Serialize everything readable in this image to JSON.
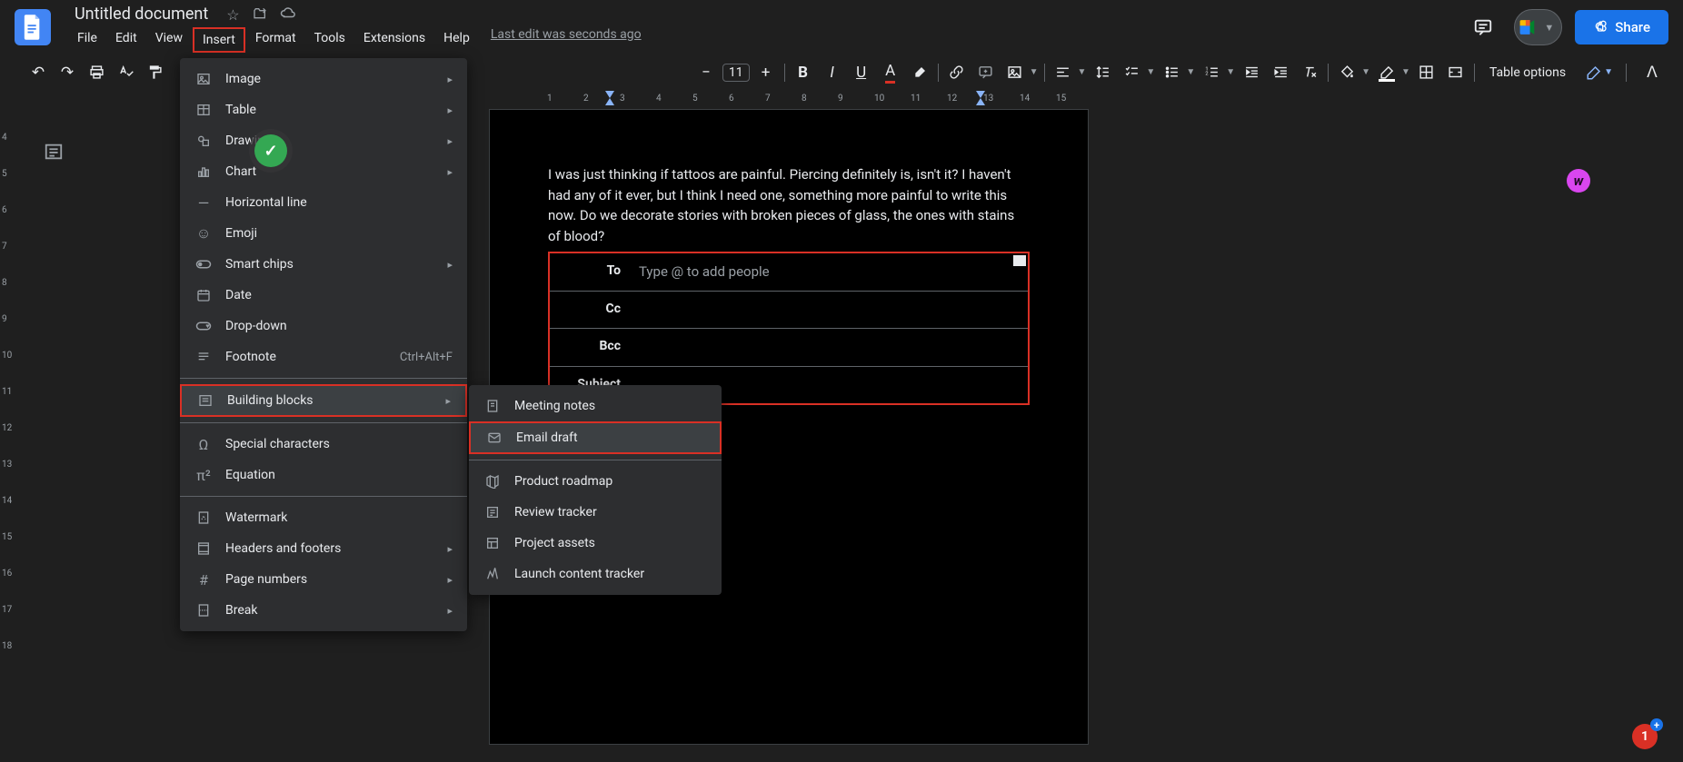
{
  "app": {
    "doc_title": "Untitled document",
    "last_edit": "Last edit was seconds ago"
  },
  "menubar": [
    "File",
    "Edit",
    "View",
    "Insert",
    "Format",
    "Tools",
    "Extensions",
    "Help"
  ],
  "header": {
    "share_label": "Share"
  },
  "toolbar": {
    "font_size": "11",
    "table_options": "Table options"
  },
  "ruler": {
    "h_numbers": [
      "1",
      "2",
      "3",
      "4",
      "5",
      "6",
      "7",
      "8",
      "9",
      "10",
      "11",
      "12",
      "13",
      "14",
      "15"
    ],
    "v_numbers": [
      "4",
      "5",
      "6",
      "7",
      "8",
      "9",
      "10",
      "11",
      "12",
      "13",
      "14",
      "15",
      "16",
      "17",
      "18"
    ]
  },
  "doc": {
    "paragraph": "I was just thinking if tattoos are painful. Piercing definitely is, isn't it? I haven't had any of it ever, but I think I need one, something more painful to write this now. Do we decorate stories with broken pieces of glass, the ones with stains of blood?"
  },
  "email": {
    "to_label": "To",
    "to_placeholder": "Type @ to add people",
    "cc_label": "Cc",
    "bcc_label": "Bcc",
    "subject_label": "Subject"
  },
  "insert_menu": {
    "image": "Image",
    "table": "Table",
    "drawing": "Drawing",
    "chart": "Chart",
    "horizontal_line": "Horizontal line",
    "emoji": "Emoji",
    "smart_chips": "Smart chips",
    "date": "Date",
    "dropdown": "Drop-down",
    "footnote": "Footnote",
    "footnote_shortcut": "Ctrl+Alt+F",
    "building_blocks": "Building blocks",
    "special_characters": "Special characters",
    "equation": "Equation",
    "watermark": "Watermark",
    "headers_footers": "Headers and footers",
    "page_numbers": "Page numbers",
    "break": "Break"
  },
  "submenu": {
    "meeting_notes": "Meeting notes",
    "email_draft": "Email draft",
    "product_roadmap": "Product roadmap",
    "review_tracker": "Review tracker",
    "project_assets": "Project assets",
    "launch_content_tracker": "Launch content tracker"
  },
  "badges": {
    "notif_count": "1"
  }
}
